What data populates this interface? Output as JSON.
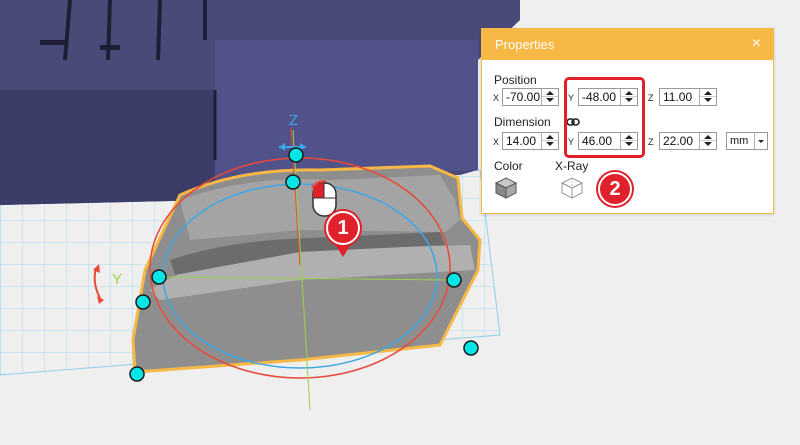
{
  "properties": {
    "title": "Properties",
    "close_glyph": "×",
    "position_label": "Position",
    "dimension_label": "Dimension",
    "position": {
      "x": "-70.00",
      "y": "-48.00",
      "z": "11.00"
    },
    "dimension": {
      "x": "14.00",
      "y": "46.00",
      "z": "22.00"
    },
    "unit": "mm",
    "axis_x": "X",
    "axis_y": "Y",
    "axis_z": "Z",
    "color_label": "Color",
    "xray_label": "X-Ray",
    "link_icon": "link-icon"
  },
  "viewport": {
    "gizmo_z_label": "Z",
    "gizmo_y_label": "Y",
    "accent_color": "#f8b845",
    "handle_color": "#00e5e5"
  },
  "annotations": {
    "callout_1": "1",
    "callout_2": "2",
    "callout_color": "#e0202a"
  }
}
